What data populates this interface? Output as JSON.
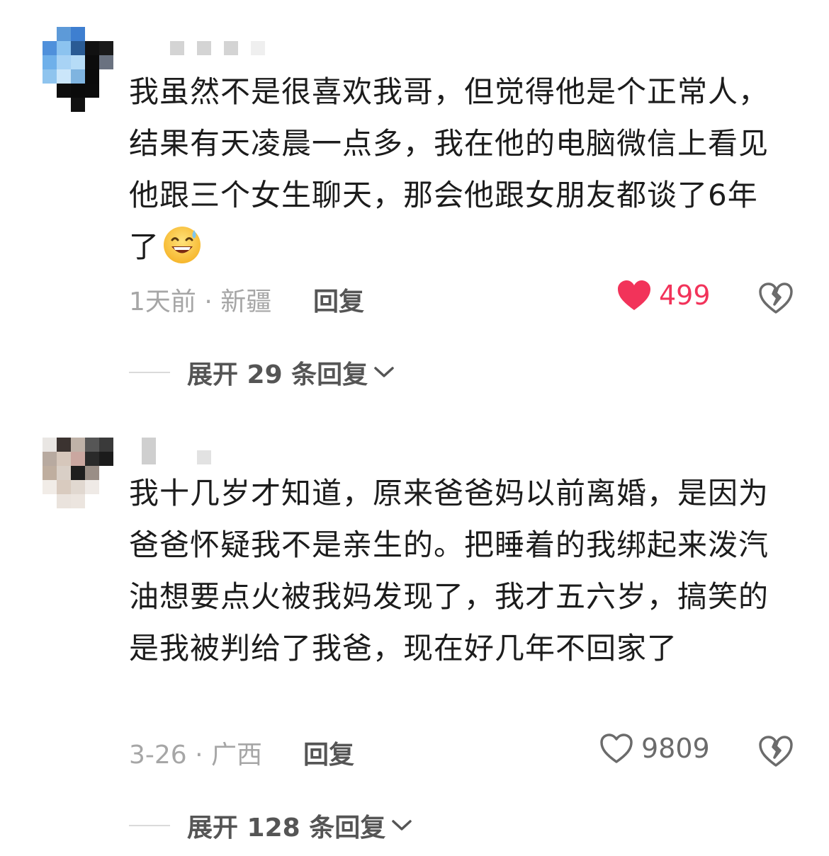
{
  "comments": [
    {
      "text": "我虽然不是很喜欢我哥，但觉得他是个正常人，结果有天凌晨一点多，我在他的电脑微信上看见他跟三个女生聊天，那会他跟女朋友都谈了6年了",
      "emoji": "grinning-sweat-face",
      "meta": "1天前 · 新疆",
      "reply_label": "回复",
      "likes": "499",
      "liked": true,
      "expand_label": "展开 29 条回复"
    },
    {
      "text": "我十几岁才知道，原来爸爸妈以前离婚，是因为爸爸怀疑我不是亲生的。把睡着的我绑起来泼汽油想要点火被我妈发现了，我才五六岁，搞笑的是我被判给了我爸，现在好几年不回家了",
      "meta": "3-26 · 广西",
      "reply_label": "回复",
      "likes": "9809",
      "liked": false,
      "expand_label": "展开 128 条回复"
    }
  ],
  "colors": {
    "like_active": "#f2335a",
    "text_primary": "#1c1c1c",
    "text_secondary": "#a6a6a6"
  }
}
